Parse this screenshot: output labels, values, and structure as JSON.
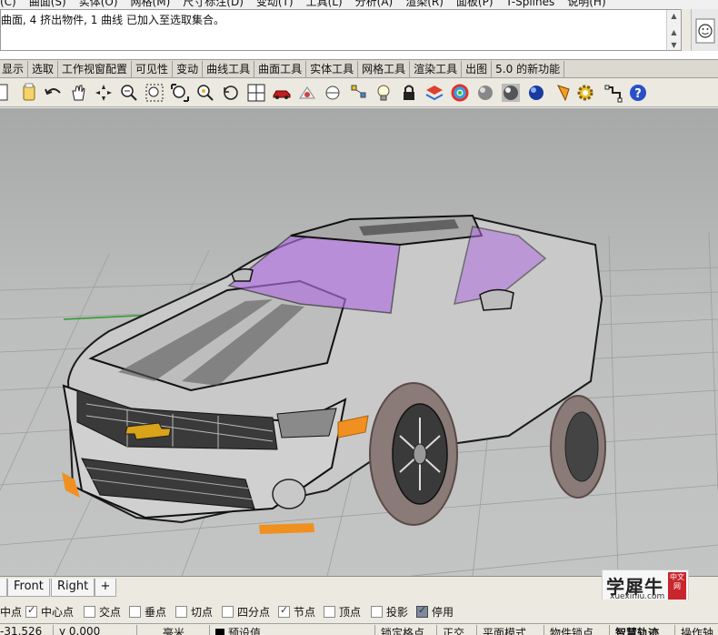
{
  "menubar": {
    "items": [
      "(C)",
      "曲面(S)",
      "实体(O)",
      "网格(M)",
      "尺寸标注(D)",
      "变动(T)",
      "工具(L)",
      "分析(A)",
      "渲染(R)",
      "面板(P)",
      "T-Splines",
      "说明(H)"
    ]
  },
  "command_history": {
    "line": "曲面, 4 挤出物件, 1 曲线 已加入至选取集合。"
  },
  "tabs": [
    "显示",
    "选取",
    "工作视窗配置",
    "可见性",
    "变动",
    "曲线工具",
    "曲面工具",
    "实体工具",
    "网格工具",
    "渲染工具",
    "出图",
    "5.0 的新功能"
  ],
  "toolbar": {
    "icons": [
      "new-file-icon",
      "open-file-icon",
      "undo-icon",
      "pan-hand-icon",
      "rotate-view-icon",
      "zoom-icon",
      "zoom-window-icon",
      "zoom-extents-icon",
      "zoom-selected-icon",
      "undo-view-icon",
      "four-viewports-icon",
      "car-icon",
      "show-objects-icon",
      "snap-icon",
      "select-points-icon",
      "lightbulb-icon",
      "lock-icon",
      "layer-icon",
      "color-wheel-icon",
      "shaded-sphere-icon",
      "rendered-sphere-icon",
      "blue-sphere-icon",
      "paint-icon",
      "settings-gear-icon",
      "grasshopper-icon",
      "help-icon"
    ]
  },
  "viewport_tabs": [
    "Front",
    "Right"
  ],
  "add_viewport_label": "+",
  "osnaps": [
    {
      "label": "中点",
      "checked": false,
      "visible_checkbox": false
    },
    {
      "label": "中心点",
      "checked": true
    },
    {
      "label": "交点",
      "checked": false
    },
    {
      "label": "垂点",
      "checked": false
    },
    {
      "label": "切点",
      "checked": false
    },
    {
      "label": "四分点",
      "checked": false
    },
    {
      "label": "节点",
      "checked": true
    },
    {
      "label": "顶点",
      "checked": false
    },
    {
      "label": "投影",
      "checked": false
    },
    {
      "label": "停用",
      "checked": true
    }
  ],
  "status": {
    "coord_x": "-31.526",
    "coord_y": "0.000",
    "unit": "毫米",
    "layer": "预设值",
    "items": [
      "锁定格点",
      "正交",
      "平面模式",
      "物件锁点",
      "智慧轨迹",
      "操作轴"
    ]
  },
  "watermark": {
    "brand": "学犀牛",
    "site": "xuexiniu.com",
    "badge": "中文网"
  },
  "colors": {
    "viewport_bg": "#b8b9b9",
    "grid_line": "#9a9b9b",
    "accent_orange": "#f09020",
    "window_glass": "#b070e0"
  }
}
